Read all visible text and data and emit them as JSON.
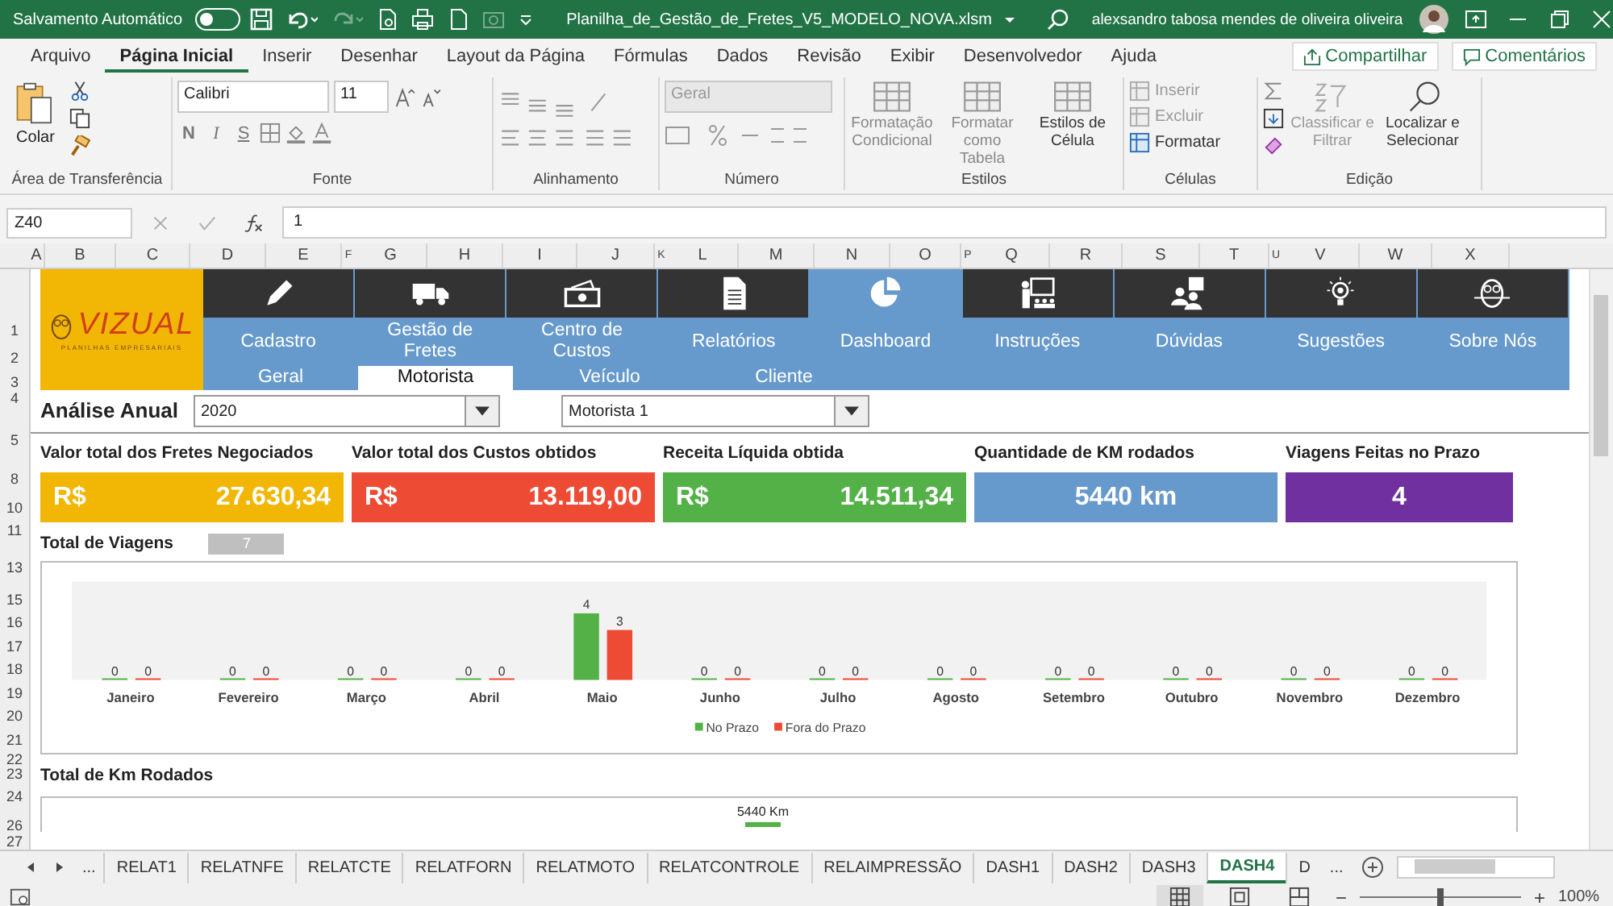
{
  "title_bar": {
    "autosave_label": "Salvamento Automático",
    "autosave_on": false,
    "filename": "Planilha_de_Gestão_de_Fretes_V5_MODELO_NOVA.xlsm",
    "user": "alexsandro tabosa mendes de oliveira oliveira"
  },
  "ribbon_tabs": [
    {
      "label": "Arquivo",
      "selected": false
    },
    {
      "label": "Página Inicial",
      "selected": true
    },
    {
      "label": "Inserir",
      "selected": false
    },
    {
      "label": "Desenhar",
      "selected": false
    },
    {
      "label": "Layout da Página",
      "selected": false
    },
    {
      "label": "Fórmulas",
      "selected": false
    },
    {
      "label": "Dados",
      "selected": false
    },
    {
      "label": "Revisão",
      "selected": false
    },
    {
      "label": "Exibir",
      "selected": false
    },
    {
      "label": "Desenvolvedor",
      "selected": false
    },
    {
      "label": "Ajuda",
      "selected": false
    }
  ],
  "share_button": "Compartilhar",
  "comments_button": "Comentários",
  "ribbon": {
    "clipboard": {
      "paste": "Colar",
      "group": "Área de Transferência"
    },
    "font": {
      "name": "Calibri",
      "size": "11",
      "bold": "N",
      "italic": "I",
      "underline": "S",
      "group": "Fonte"
    },
    "alignment": {
      "group": "Alinhamento"
    },
    "number": {
      "format": "Geral",
      "group": "Número"
    },
    "styles": {
      "items": [
        "Formatação Condicional",
        "Formatar como Tabela",
        "Estilos de Célula"
      ],
      "group": "Estilos"
    },
    "cells": {
      "items": [
        {
          "label": "Inserir",
          "disabled": true
        },
        {
          "label": "Excluir",
          "disabled": true
        },
        {
          "label": "Formatar",
          "disabled": false
        }
      ],
      "group": "Células"
    },
    "editing": {
      "sort": "Classificar e Filtrar",
      "find": "Localizar e Selecionar",
      "group": "Edição"
    }
  },
  "formula_bar": {
    "name_box": "Z40",
    "value": "1"
  },
  "column_headers": [
    "A",
    "B",
    "C",
    "D",
    "E",
    "F",
    "G",
    "H",
    "I",
    "J",
    "K",
    "L",
    "M",
    "N",
    "O",
    "P",
    "Q",
    "R",
    "S",
    "T",
    "U",
    "V",
    "W",
    "X"
  ],
  "row_headers": [
    "1",
    "2",
    "3",
    "4",
    "5",
    "8",
    "10",
    "11",
    "13",
    "15",
    "16",
    "17",
    "18",
    "19",
    "20",
    "21",
    "22",
    "23",
    "24",
    "26",
    "27"
  ],
  "dashboard": {
    "logo": {
      "name": "VIZUAL",
      "tagline": "PLANILHAS EMPRESARIAIS"
    },
    "nav": [
      {
        "label": "Cadastro",
        "selected": false
      },
      {
        "label": "Gestão de Fretes",
        "selected": false
      },
      {
        "label": "Centro de Custos",
        "selected": false
      },
      {
        "label": "Relatórios",
        "selected": false
      },
      {
        "label": "Dashboard",
        "selected": true
      },
      {
        "label": "Instruções",
        "selected": false
      },
      {
        "label": "Dúvidas",
        "selected": false
      },
      {
        "label": "Sugestões",
        "selected": false
      },
      {
        "label": "Sobre Nós",
        "selected": false
      }
    ],
    "subtabs": [
      {
        "label": "Geral",
        "selected": false
      },
      {
        "label": "Motorista",
        "selected": true
      },
      {
        "label": "Veículo",
        "selected": false
      },
      {
        "label": "Cliente",
        "selected": false
      }
    ],
    "filters": {
      "title": "Análise Anual",
      "year": "2020",
      "driver": "Motorista 1"
    },
    "kpis": [
      {
        "label": "Valor total dos Fretes Negociados",
        "currency": "R$",
        "value": "27.630,34",
        "color": "#f2b705"
      },
      {
        "label": "Valor total dos Custos obtidos",
        "currency": "R$",
        "value": "13.119,00",
        "color": "#ee4b35"
      },
      {
        "label": "Receita Líquida obtida",
        "currency": "R$",
        "value": "14.511,34",
        "color": "#53b147"
      },
      {
        "label": "Quantidade de KM rodados",
        "value": "5440 km",
        "color": "#6699cc"
      },
      {
        "label": "Viagens Feitas no Prazo",
        "value": "4",
        "color": "#7030a0"
      }
    ],
    "trips": {
      "label": "Total de Viagens",
      "count": "7",
      "chart_data": {
        "type": "bar",
        "categories": [
          "Janeiro",
          "Fevereiro",
          "Março",
          "Abril",
          "Maio",
          "Junho",
          "Julho",
          "Agosto",
          "Setembro",
          "Outubro",
          "Novembro",
          "Dezembro"
        ],
        "series": [
          {
            "name": "No Prazo",
            "color": "#53b147",
            "values": [
              0,
              0,
              0,
              0,
              4,
              0,
              0,
              0,
              0,
              0,
              0,
              0
            ]
          },
          {
            "name": "Fora do Prazo",
            "color": "#ee4b35",
            "values": [
              0,
              0,
              0,
              0,
              3,
              0,
              0,
              0,
              0,
              0,
              0,
              0
            ]
          }
        ],
        "data_labels": true,
        "legend": "bottom"
      }
    },
    "km": {
      "label": "Total de Km Rodados",
      "value_label": "5440 Km"
    }
  },
  "sheet_tabs": [
    {
      "label": "RELAT1",
      "selected": false
    },
    {
      "label": "RELATNFE",
      "selected": false
    },
    {
      "label": "RELATCTE",
      "selected": false
    },
    {
      "label": "RELATFORN",
      "selected": false
    },
    {
      "label": "RELATMOTO",
      "selected": false
    },
    {
      "label": "RELATCONTROLE",
      "selected": false
    },
    {
      "label": "RELAIMPRESSÃO",
      "selected": false
    },
    {
      "label": "DASH1",
      "selected": false
    },
    {
      "label": "DASH2",
      "selected": false
    },
    {
      "label": "DASH3",
      "selected": false
    },
    {
      "label": "DASH4",
      "selected": true
    },
    {
      "label": "D",
      "selected": false
    }
  ],
  "sheet_more": "...",
  "sheet_more_end": "...",
  "status_bar": {
    "zoom": "100%",
    "zoom_out": "−",
    "zoom_in": "+",
    "zoom_slider": {
      "level": 0.5
    }
  }
}
